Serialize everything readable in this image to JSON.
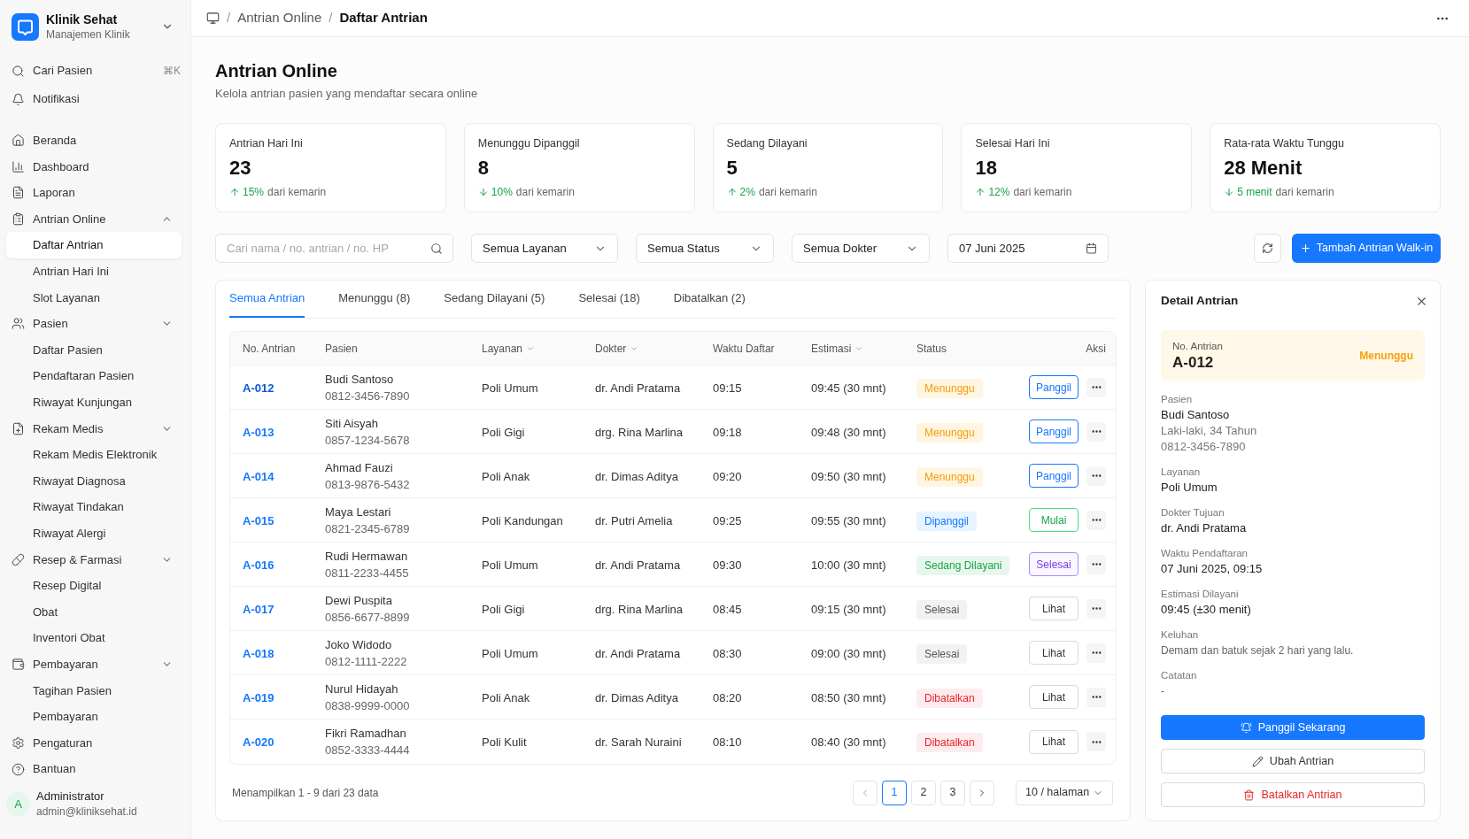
{
  "sidebar": {
    "brand": {
      "name": "Klinik Sehat",
      "subtitle": "Manajemen Klinik"
    },
    "quick": [
      {
        "label": "Cari Pasien",
        "shortcut": "⌘K"
      },
      {
        "label": "Notifikasi"
      }
    ],
    "items": [
      {
        "label": "Beranda",
        "selected": false
      },
      {
        "label": "Dashboard",
        "selected": false
      },
      {
        "label": "Laporan",
        "selected": false
      },
      {
        "label": "Antrian Online",
        "selected": false,
        "expanded": true,
        "children": [
          {
            "label": "Daftar Antrian",
            "selected": true
          },
          {
            "label": "Antrian Hari Ini",
            "selected": false
          },
          {
            "label": "Slot Layanan",
            "selected": false
          }
        ]
      },
      {
        "label": "Pasien",
        "selected": false,
        "expanded": false,
        "children": [
          {
            "label": "Daftar Pasien",
            "selected": false
          },
          {
            "label": "Pendaftaran Pasien",
            "selected": false
          },
          {
            "label": "Riwayat Kunjungan",
            "selected": false
          }
        ]
      },
      {
        "label": "Rekam Medis",
        "selected": false,
        "expanded": false,
        "children": [
          {
            "label": "Rekam Medis Elektronik",
            "selected": false
          },
          {
            "label": "Riwayat Diagnosa",
            "selected": false
          },
          {
            "label": "Riwayat Tindakan",
            "selected": false
          },
          {
            "label": "Riwayat Alergi",
            "selected": false
          }
        ]
      },
      {
        "label": "Resep & Farmasi",
        "selected": false,
        "expanded": false,
        "children": [
          {
            "label": "Resep Digital",
            "selected": false
          },
          {
            "label": "Obat",
            "selected": false
          },
          {
            "label": "Inventori Obat",
            "selected": false
          }
        ]
      },
      {
        "label": "Pembayaran",
        "selected": false,
        "expanded": false,
        "children": [
          {
            "label": "Tagihan Pasien",
            "selected": false
          },
          {
            "label": "Pembayaran",
            "selected": false
          }
        ]
      },
      {
        "label": "Pengaturan",
        "selected": false
      },
      {
        "label": "Bantuan",
        "selected": false
      }
    ],
    "user": {
      "initial": "A",
      "name": "Administrator",
      "email": "admin@kliniksehat.id"
    }
  },
  "header": {
    "breadcrumb": [
      {
        "separator": "/",
        "label": "Antrian Online",
        "current": false
      },
      {
        "separator": "/",
        "label": "Daftar Antrian",
        "current": true
      }
    ]
  },
  "page": {
    "title": "Antrian Online",
    "subtitle": "Kelola antrian pasien yang mendaftar secara online"
  },
  "stats": [
    {
      "label": "Antrian Hari Ini",
      "value": "23",
      "increase": true,
      "change": "15%",
      "note": "dari kemarin"
    },
    {
      "label": "Menunggu Dipanggil",
      "value": "8",
      "increase": false,
      "change": "10%",
      "note": "dari kemarin"
    },
    {
      "label": "Sedang Dilayani",
      "value": "5",
      "increase": true,
      "change": "2%",
      "note": "dari kemarin"
    },
    {
      "label": "Selesai Hari Ini",
      "value": "18",
      "increase": true,
      "change": "12%",
      "note": "dari kemarin"
    },
    {
      "label": "Rata-rata Waktu Tunggu",
      "value": "28 Menit",
      "increase": false,
      "change": "5 menit",
      "note": "dari kemarin"
    }
  ],
  "filters": {
    "search": {
      "placeholder": "Cari nama / no. antrian / no. HP"
    },
    "selects": [
      {
        "value": "Semua Layanan"
      },
      {
        "value": "Semua Status"
      },
      {
        "value": "Semua Dokter"
      }
    ],
    "date": {
      "value": "07 Juni 2025"
    },
    "add_button": "Tambah Antrian Walk-in"
  },
  "tabs": [
    {
      "label": "Semua Antrian",
      "selected": true
    },
    {
      "label": "Menunggu (8)",
      "selected": false
    },
    {
      "label": "Sedang Dilayani (5)",
      "selected": false
    },
    {
      "label": "Selesai (18)",
      "selected": false
    },
    {
      "label": "Dibatalkan (2)",
      "selected": false
    }
  ],
  "table": {
    "columns": [
      {
        "label": "No. Antrian",
        "sortable": false
      },
      {
        "label": "Pasien",
        "sortable": false
      },
      {
        "label": "Layanan",
        "sortable": true
      },
      {
        "label": "Dokter",
        "sortable": true
      },
      {
        "label": "Waktu Daftar",
        "sortable": false
      },
      {
        "label": "Estimasi",
        "sortable": true
      },
      {
        "label": "Status",
        "sortable": false
      },
      {
        "label": "Aksi",
        "sortable": false
      }
    ],
    "rows": [
      {
        "no": "A-012",
        "selected": true,
        "name": "Budi Santoso",
        "phone": "0812-3456-7890",
        "service": "Poli Umum",
        "doctor": "dr. Andi Pratama",
        "time": "09:15",
        "estimate": "09:45 (30 mnt)",
        "status": {
          "label": "Menunggu",
          "kind": "waiting"
        },
        "action": {
          "label": "Panggil",
          "kind": "call"
        }
      },
      {
        "no": "A-013",
        "selected": false,
        "name": "Siti Aisyah",
        "phone": "0857-1234-5678",
        "service": "Poli Gigi",
        "doctor": "drg. Rina Marlina",
        "time": "09:18",
        "estimate": "09:48 (30 mnt)",
        "status": {
          "label": "Menunggu",
          "kind": "waiting"
        },
        "action": {
          "label": "Panggil",
          "kind": "call"
        }
      },
      {
        "no": "A-014",
        "selected": false,
        "name": "Ahmad Fauzi",
        "phone": "0813-9876-5432",
        "service": "Poli Anak",
        "doctor": "dr. Dimas Aditya",
        "time": "09:20",
        "estimate": "09:50 (30 mnt)",
        "status": {
          "label": "Menunggu",
          "kind": "waiting"
        },
        "action": {
          "label": "Panggil",
          "kind": "call"
        }
      },
      {
        "no": "A-015",
        "selected": false,
        "name": "Maya Lestari",
        "phone": "0821-2345-6789",
        "service": "Poli Kandungan",
        "doctor": "dr. Putri Amelia",
        "time": "09:25",
        "estimate": "09:55 (30 mnt)",
        "status": {
          "label": "Dipanggil",
          "kind": "called"
        },
        "action": {
          "label": "Mulai",
          "kind": "start"
        }
      },
      {
        "no": "A-016",
        "selected": false,
        "name": "Rudi Hermawan",
        "phone": "0811-2233-4455",
        "service": "Poli Umum",
        "doctor": "dr. Andi Pratama",
        "time": "09:30",
        "estimate": "10:00 (30 mnt)",
        "status": {
          "label": "Sedang Dilayani",
          "kind": "serving"
        },
        "action": {
          "label": "Selesai",
          "kind": "finish"
        }
      },
      {
        "no": "A-017",
        "selected": false,
        "name": "Dewi Puspita",
        "phone": "0856-6677-8899",
        "service": "Poli Gigi",
        "doctor": "drg. Rina Marlina",
        "time": "08:45",
        "estimate": "09:15 (30 mnt)",
        "status": {
          "label": "Selesai",
          "kind": "done"
        },
        "action": {
          "label": "Lihat",
          "kind": "view"
        }
      },
      {
        "no": "A-018",
        "selected": false,
        "name": "Joko Widodo",
        "phone": "0812-1111-2222",
        "service": "Poli Umum",
        "doctor": "dr. Andi Pratama",
        "time": "08:30",
        "estimate": "09:00 (30 mnt)",
        "status": {
          "label": "Selesai",
          "kind": "done"
        },
        "action": {
          "label": "Lihat",
          "kind": "view"
        }
      },
      {
        "no": "A-019",
        "selected": false,
        "name": "Nurul Hidayah",
        "phone": "0838-9999-0000",
        "service": "Poli Anak",
        "doctor": "dr. Dimas Aditya",
        "time": "08:20",
        "estimate": "08:50 (30 mnt)",
        "status": {
          "label": "Dibatalkan",
          "kind": "cancelled"
        },
        "action": {
          "label": "Lihat",
          "kind": "view"
        }
      },
      {
        "no": "A-020",
        "selected": false,
        "name": "Fikri Ramadhan",
        "phone": "0852-3333-4444",
        "service": "Poli Kulit",
        "doctor": "dr. Sarah Nuraini",
        "time": "08:10",
        "estimate": "08:40 (30 mnt)",
        "status": {
          "label": "Dibatalkan",
          "kind": "cancelled"
        },
        "action": {
          "label": "Lihat",
          "kind": "view"
        }
      }
    ],
    "summary": "Menampilkan 1 - 9 dari 23 data",
    "pages": [
      {
        "label": "1",
        "selected": true
      },
      {
        "label": "2",
        "selected": false
      },
      {
        "label": "3",
        "selected": false
      }
    ],
    "page_size": "10 / halaman"
  },
  "detail": {
    "title": "Detail Antrian",
    "queue_label": "No. Antrian",
    "queue_no": "A-012",
    "status": {
      "label": "Menunggu",
      "kind": "waiting"
    },
    "fields": [
      {
        "label": "Pasien",
        "lines": [
          {
            "text": "Budi Santoso",
            "kind": "primary"
          },
          {
            "text": "Laki-laki, 34 Tahun",
            "kind": "secondary"
          },
          {
            "text": "0812-3456-7890",
            "kind": "secondary"
          }
        ]
      },
      {
        "label": "Layanan",
        "lines": [
          {
            "text": "Poli Umum",
            "kind": "primary"
          }
        ]
      },
      {
        "label": "Dokter Tujuan",
        "lines": [
          {
            "text": "dr. Andi Pratama",
            "kind": "primary"
          }
        ]
      },
      {
        "label": "Waktu Pendaftaran",
        "lines": [
          {
            "text": "07 Juni 2025, 09:15",
            "kind": "primary"
          }
        ]
      },
      {
        "label": "Estimasi Dilayani",
        "lines": [
          {
            "text": "09:45 (±30 menit)",
            "kind": "primary"
          }
        ]
      },
      {
        "label": "Keluhan",
        "lines": [
          {
            "text": "Demam dan batuk sejak 2 hari yang lalu.",
            "kind": "secondary"
          }
        ]
      },
      {
        "label": "Catatan",
        "lines": [
          {
            "text": "-",
            "kind": "secondary"
          }
        ]
      }
    ],
    "buttons": [
      {
        "label": "Panggil Sekarang",
        "kind": "primary"
      },
      {
        "label": "Ubah Antrian",
        "kind": "outline"
      },
      {
        "label": "Batalkan Antrian",
        "kind": "danger"
      }
    ]
  }
}
